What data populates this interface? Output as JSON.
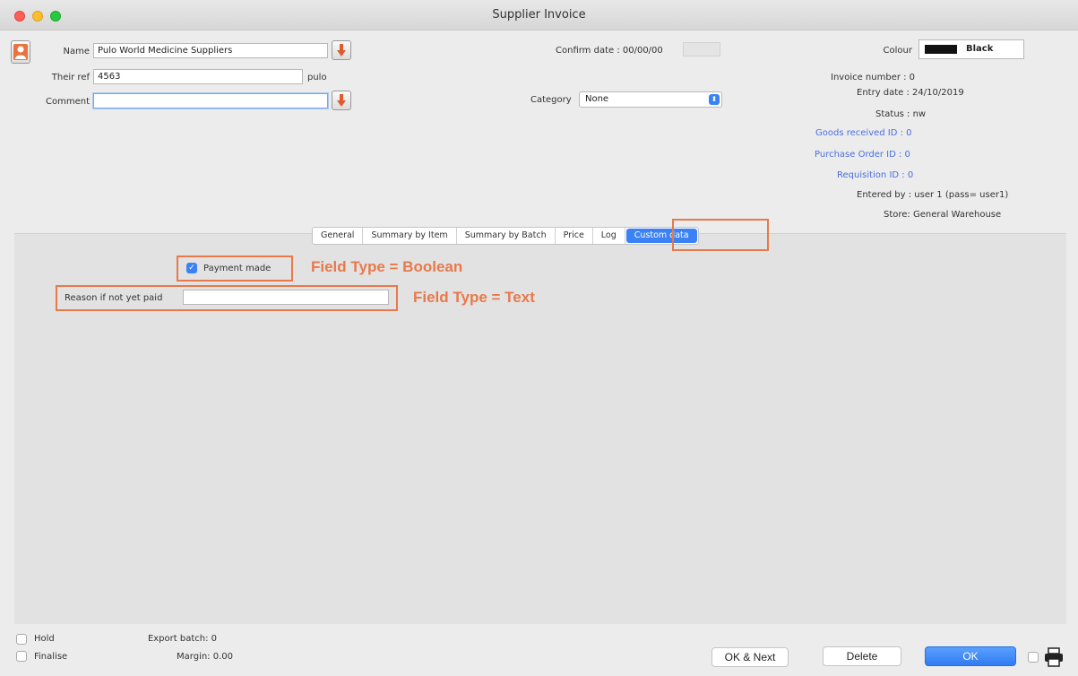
{
  "window": {
    "title": "Supplier Invoice"
  },
  "header": {
    "name_label": "Name",
    "name_value": "Pulo World Medicine Suppliers",
    "their_ref_label": "Their ref",
    "their_ref_value": "4563",
    "supplier_code": "pulo",
    "comment_label": "Comment",
    "comment_value": "",
    "confirm_date": "Confirm date : 00/00/00",
    "category_label": "Category",
    "category_value": "None",
    "colour_label": "Colour",
    "colour_value": "Black",
    "colour_hex": "#111111"
  },
  "info": {
    "invoice_number": "Invoice number : 0",
    "entry_date": "Entry date : 24/10/2019",
    "status": "Status : nw",
    "goods_received": "Goods received ID : 0",
    "purchase_order": "Purchase Order ID : 0",
    "requisition": "Requisition ID : 0",
    "entered_by": "Entered by : user 1 (pass= user1)",
    "store": "Store: General Warehouse"
  },
  "tabs": [
    {
      "label": "General"
    },
    {
      "label": "Summary by Item"
    },
    {
      "label": "Summary by Batch"
    },
    {
      "label": "Price"
    },
    {
      "label": "Log"
    },
    {
      "label": "Custom data"
    }
  ],
  "custom_data": {
    "payment_made_label": "Payment made",
    "payment_made_checked": true,
    "reason_label": "Reason if not yet paid",
    "reason_value": ""
  },
  "annotations": {
    "boolean": "Field Type = Boolean",
    "text": "Field Type = Text",
    "color": "#e8794a"
  },
  "footer": {
    "hold_label": "Hold",
    "finalise_label": "Finalise",
    "export_batch": "Export batch: 0",
    "margin": "Margin: 0.00",
    "ok_next_label": "OK & Next",
    "delete_label": "Delete",
    "ok_label": "OK"
  },
  "accent_color": "#3b82f6"
}
